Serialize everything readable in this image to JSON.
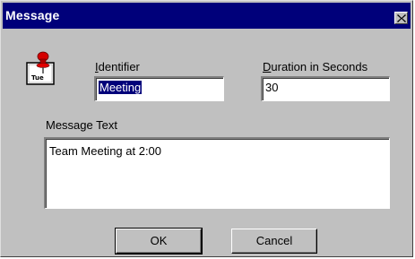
{
  "window": {
    "title": "Message"
  },
  "icons": {
    "app": "pushpin-note-icon",
    "app_caption": "Tue",
    "close": "close-icon"
  },
  "fields": {
    "identifier": {
      "label_hotkey": "I",
      "label_rest": "dentifier",
      "value": "Meeting"
    },
    "duration": {
      "label_hotkey": "D",
      "label_rest": "uration in Seconds",
      "value": "30"
    },
    "message": {
      "label": "Message Text",
      "value": "Team Meeting at 2:00"
    }
  },
  "buttons": {
    "ok": "OK",
    "cancel": "Cancel"
  },
  "colors": {
    "titlebar": "#00007a",
    "face": "#c0c0c0",
    "selection": "#00007a"
  }
}
